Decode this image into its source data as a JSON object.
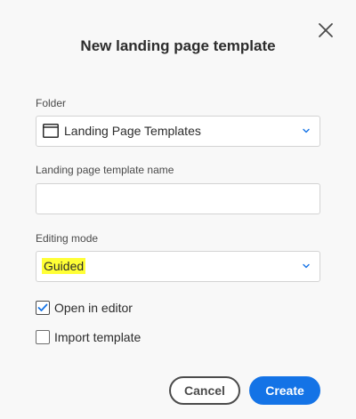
{
  "dialog": {
    "title": "New landing page template",
    "close_icon": "close-icon"
  },
  "folder": {
    "label": "Folder",
    "value": "Landing Page Templates",
    "icon": "folder-icon"
  },
  "name_field": {
    "label": "Landing page template name",
    "value": "",
    "placeholder": ""
  },
  "editing_mode": {
    "label": "Editing mode",
    "value": "Guided",
    "highlight_color": "#ffff36"
  },
  "options": {
    "open_in_editor": {
      "label": "Open in editor",
      "checked": true
    },
    "import_template": {
      "label": "Import template",
      "checked": false
    }
  },
  "buttons": {
    "cancel_label": "Cancel",
    "create_label": "Create"
  },
  "colors": {
    "accent": "#1473e6",
    "text": "#2c2c2c",
    "background": "#f8f8f8"
  }
}
